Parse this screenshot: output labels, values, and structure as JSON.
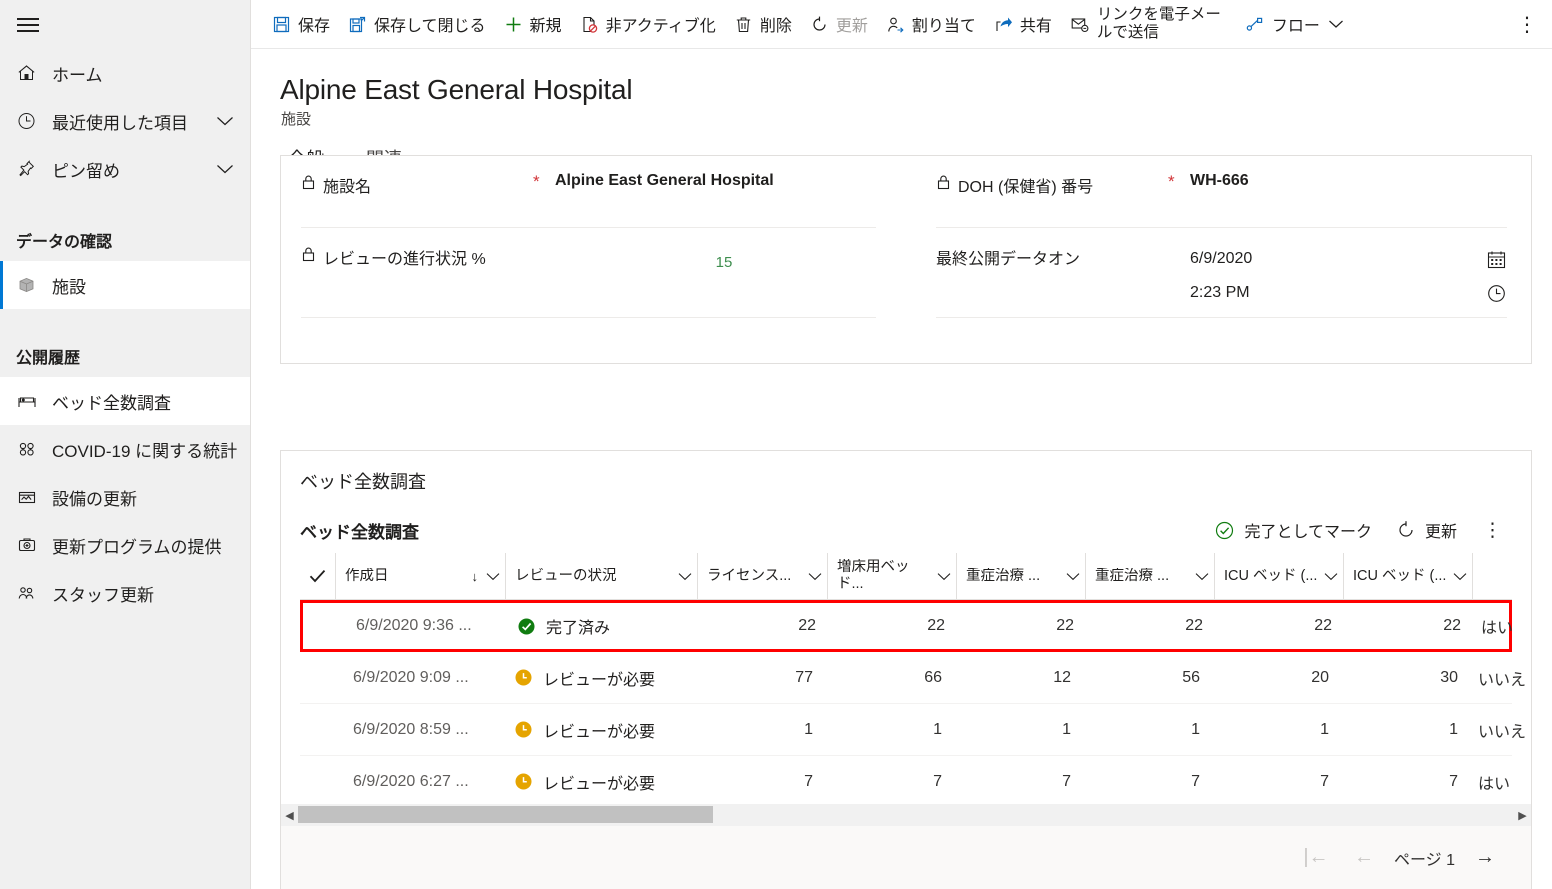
{
  "sidebar": {
    "hamburger_label": "メニュー",
    "top_items": [
      {
        "label": "ホーム",
        "icon": "home-icon",
        "chevron": false
      },
      {
        "label": "最近使用した項目",
        "icon": "clock-icon",
        "chevron": true
      },
      {
        "label": "ピン留め",
        "icon": "pin-icon",
        "chevron": true
      }
    ],
    "groups": [
      {
        "title": "データの確認",
        "items": [
          {
            "label": "施設",
            "icon": "cube-icon",
            "selected": true
          }
        ]
      },
      {
        "title": "公開履歴",
        "items": [
          {
            "label": "ベッド全数調査",
            "icon": "bed-icon",
            "active": true
          },
          {
            "label": "COVID-19 に関する統計",
            "icon": "virus-icon",
            "active": false
          },
          {
            "label": "設備の更新",
            "icon": "facility-icon",
            "active": false
          },
          {
            "label": "更新プログラムの提供",
            "icon": "supplies-icon",
            "active": false
          },
          {
            "label": "スタッフ更新",
            "icon": "staff-icon",
            "active": false
          }
        ]
      }
    ]
  },
  "commandbar": {
    "items": [
      {
        "label": "保存",
        "icon": "save-icon",
        "disabled": false,
        "caret": false
      },
      {
        "label": "保存して閉じる",
        "icon": "save-close-icon",
        "disabled": false,
        "caret": false
      },
      {
        "label": "新規",
        "icon": "plus-icon",
        "disabled": false,
        "caret": false
      },
      {
        "label": "非アクティブ化",
        "icon": "deactivate-icon",
        "disabled": false,
        "caret": false
      },
      {
        "label": "削除",
        "icon": "trash-icon",
        "disabled": false,
        "caret": false
      },
      {
        "label": "更新",
        "icon": "refresh-icon",
        "disabled": true,
        "caret": false
      },
      {
        "label": "割り当て",
        "icon": "assign-user-icon",
        "disabled": false,
        "caret": false
      },
      {
        "label": "共有",
        "icon": "share-icon",
        "disabled": false,
        "caret": false
      },
      {
        "label": "リンクを電子メールで送信",
        "icon": "email-link-icon",
        "disabled": false,
        "caret": false
      },
      {
        "label": "フロー",
        "icon": "flow-icon",
        "disabled": false,
        "caret": true
      }
    ],
    "overflow_label": "その他のコマンド"
  },
  "record": {
    "title": "Alpine East General Hospital",
    "subtitle": "施設",
    "tabs": [
      {
        "label": "全般",
        "active": true
      },
      {
        "label": "関連",
        "active": false
      }
    ]
  },
  "form": {
    "facility_name": {
      "label": "施設名",
      "required_marker": "*",
      "value": "Alpine East General Hospital"
    },
    "review_progress": {
      "label": "レビューの進行状況 %",
      "value": "15",
      "percent": 15
    },
    "doh_number": {
      "label": "DOH (保健省) 番号",
      "required_marker": "*",
      "value": "WH-666"
    },
    "last_published": {
      "label": "最終公開データオン",
      "date": "6/9/2020",
      "time": "2:23 PM",
      "date_icon": "calendar-icon",
      "time_icon": "clock-icon"
    }
  },
  "grid": {
    "section_title": "ベッド全数調査",
    "subtitle": "ベッド全数調査",
    "commands": [
      {
        "label": "完了としてマーク",
        "icon": "check-circle-icon"
      },
      {
        "label": "更新",
        "icon": "refresh-icon"
      }
    ],
    "overflow_label": "その他のコマンド",
    "columns": [
      {
        "label": "作成日",
        "sort": "↓",
        "menu": true
      },
      {
        "label": "レビューの状況",
        "sort": "",
        "menu": true
      },
      {
        "label": "ライセンス...",
        "sort": "",
        "menu": true
      },
      {
        "label": "増床用ベッド...",
        "sort": "",
        "menu": true
      },
      {
        "label": "重症治療 ...",
        "sort": "",
        "menu": true
      },
      {
        "label": "重症治療 ...",
        "sort": "",
        "menu": true
      },
      {
        "label": "ICU ベッド (...",
        "sort": "",
        "menu": true
      },
      {
        "label": "ICU ベッド (...",
        "sort": "",
        "menu": true
      }
    ],
    "header_save_icon": "save-columns-icon",
    "select_all_icon": "checkmark-icon",
    "rows": [
      {
        "created": "6/9/2020 9:36 ...",
        "status": "完了済み",
        "status_icon": "complete-icon",
        "licensed": "22",
        "surge": "22",
        "critical1": "22",
        "critical2": "22",
        "icu1": "22",
        "icu2": "22",
        "flag": "はい",
        "highlighted": true
      },
      {
        "created": "6/9/2020 9:09 ...",
        "status": "レビューが必要",
        "status_icon": "pending-icon",
        "licensed": "77",
        "surge": "66",
        "critical1": "12",
        "critical2": "56",
        "icu1": "20",
        "icu2": "30",
        "flag": "いいえ",
        "highlighted": false
      },
      {
        "created": "6/9/2020 8:59 ...",
        "status": "レビューが必要",
        "status_icon": "pending-icon",
        "licensed": "1",
        "surge": "1",
        "critical1": "1",
        "critical2": "1",
        "icu1": "1",
        "icu2": "1",
        "flag": "いいえ",
        "highlighted": false
      },
      {
        "created": "6/9/2020 6:27 ...",
        "status": "レビューが必要",
        "status_icon": "pending-icon",
        "licensed": "7",
        "surge": "7",
        "critical1": "7",
        "critical2": "7",
        "icu1": "7",
        "icu2": "7",
        "flag": "はい",
        "highlighted": false
      }
    ],
    "pager": {
      "first_label": "|←",
      "prev_label": "←",
      "page_label": "ページ 1",
      "next_label": "→"
    }
  },
  "colors": {
    "accent": "#0f6cbd",
    "selected_bar": "#0078d4",
    "progress_fill": "#27a344",
    "progress_track": "#c8c6c4",
    "required": "#d13438",
    "status_complete": "#107c10",
    "status_pending": "#e5a400",
    "highlight_border": "#ff0000",
    "sidebar_bg": "#f0f0f0"
  }
}
